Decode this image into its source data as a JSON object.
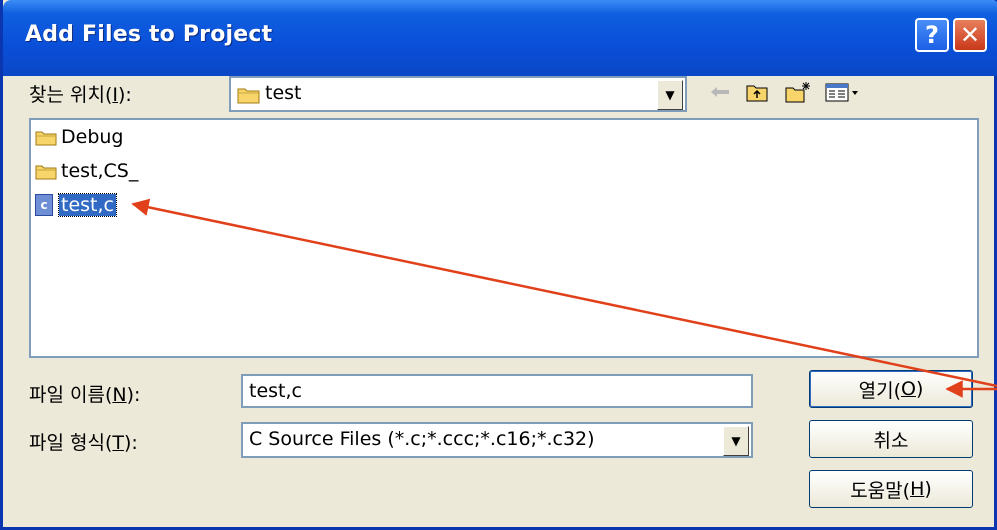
{
  "window": {
    "title": "Add Files to Project"
  },
  "titlebar_buttons": {
    "help": "?",
    "close": "✕"
  },
  "look_in": {
    "label_prefix": "찾는 위치(",
    "label_key": "I",
    "label_suffix": "):",
    "value": "test"
  },
  "files": [
    {
      "name": "Debug",
      "type": "folder"
    },
    {
      "name": "test,CS_",
      "type": "folder"
    },
    {
      "name": "test,c",
      "type": "c-file",
      "selected": true
    }
  ],
  "filename": {
    "label_prefix": "파일 이름(",
    "label_key": "N",
    "label_suffix": "):",
    "value": "test,c"
  },
  "filetype": {
    "label_prefix": "파일 형식(",
    "label_key": "T",
    "label_suffix": "):",
    "value": "C Source Files (*.c;*.ccc;*.c16;*.c32)"
  },
  "buttons": {
    "open_prefix": "열기(",
    "open_key": "O",
    "open_suffix": ")",
    "cancel": "취소",
    "help_prefix": "도움말(",
    "help_key": "H",
    "help_suffix": ")"
  },
  "icons": {
    "c_file": "c"
  },
  "colors": {
    "titlebar": "#0a4fd8",
    "annotation_arrow": "#e0401a",
    "selection": "#316ac5"
  }
}
